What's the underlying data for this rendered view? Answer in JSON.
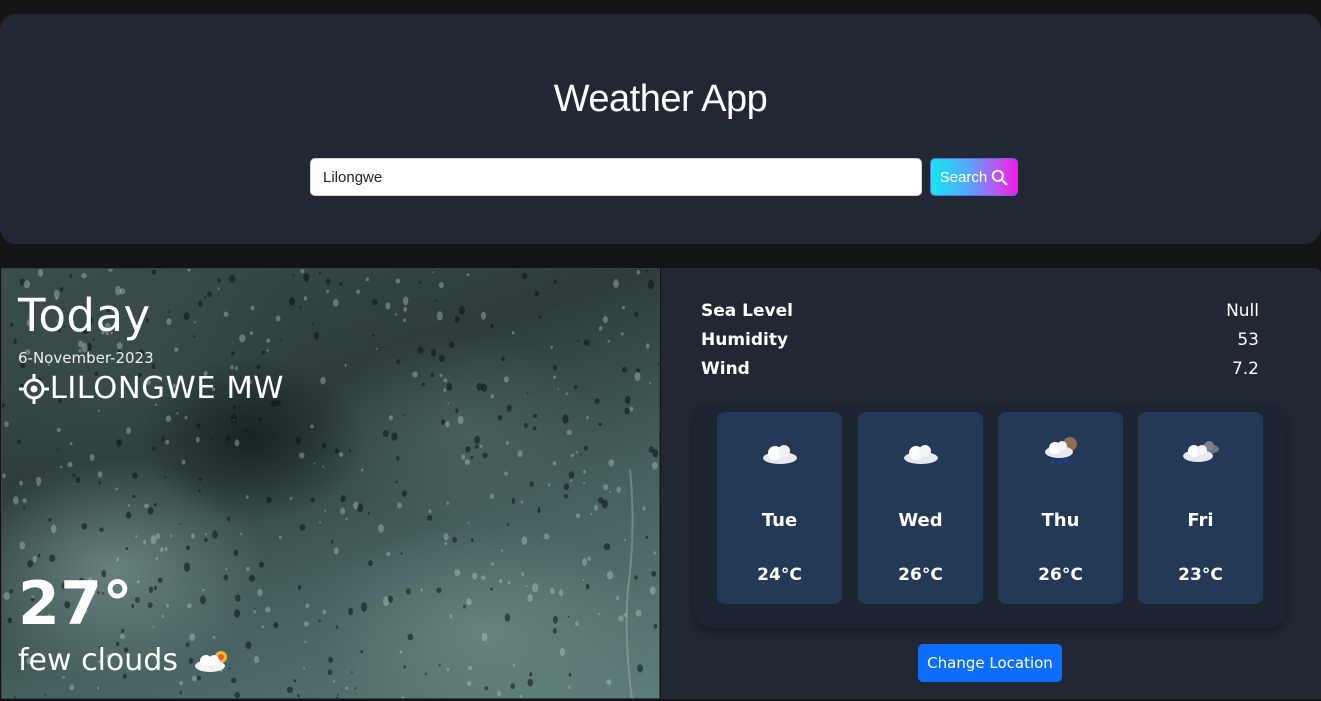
{
  "header": {
    "title": "Weather App",
    "search_value": "Lilongwe",
    "search_button_label": "Search"
  },
  "today": {
    "label": "Today",
    "date": "6-November-2023",
    "location": "LILONGWE MW",
    "temperature": "27°",
    "description": "few clouds"
  },
  "stats": [
    {
      "label": "Sea Level",
      "value": "Null"
    },
    {
      "label": "Humidity",
      "value": "53"
    },
    {
      "label": "Wind",
      "value": "7.2"
    }
  ],
  "forecast": [
    {
      "day": "Tue",
      "temp": "24°C",
      "icon": "cloud-icon"
    },
    {
      "day": "Wed",
      "temp": "26°C",
      "icon": "cloud-icon"
    },
    {
      "day": "Thu",
      "temp": "26°C",
      "icon": "rain-cloud-icon"
    },
    {
      "day": "Fri",
      "temp": "23°C",
      "icon": "broken-clouds-icon"
    }
  ],
  "change_location_label": "Change Location",
  "colors": {
    "header_bg": "#212733",
    "card_bg": "#243956",
    "button_blue": "#0d6efd"
  }
}
